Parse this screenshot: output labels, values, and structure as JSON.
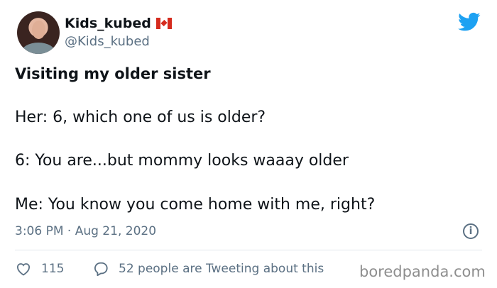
{
  "profile": {
    "display_name": "Kids_kubed",
    "flag_icon": "canada-flag-icon",
    "handle": "@Kids_kubed",
    "avatar_icon": "avatar"
  },
  "brand": {
    "logo": "twitter-bird-icon",
    "color": "#1da1f2"
  },
  "tweet": {
    "title": "Visiting my older sister",
    "lines": [
      "Her: 6, which one of us is older?",
      "6: You are...but mommy looks waaay older",
      "Me: You know you come home with me, right?"
    ],
    "timestamp": "3:06 PM · Aug 21, 2020"
  },
  "actions": {
    "like_count": "115",
    "tweeting_text": "52 people are Tweeting about this"
  },
  "watermark": "boredpanda.com",
  "colors": {
    "text": "#0f1419",
    "secondary": "#5b7083",
    "divider": "#e1e8ed",
    "watermark": "#8e8e8e"
  }
}
